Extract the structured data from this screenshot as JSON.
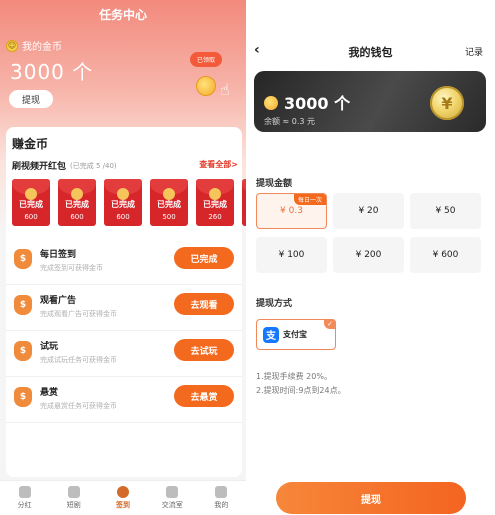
{
  "left": {
    "title": "任务中心",
    "coins": {
      "label": "我的金币",
      "amount": "3000 个",
      "received_tag": "已领取",
      "withdraw_label": "提现"
    },
    "earn": {
      "title": "赚金币",
      "video_title": "刷视频开红包",
      "video_progress": "(已完成 5 /40)",
      "view_all": "查看全部>",
      "packets": [
        {
          "state": "已完成",
          "amount": "600"
        },
        {
          "state": "已完成",
          "amount": "600"
        },
        {
          "state": "已完成",
          "amount": "600"
        },
        {
          "state": "已完成",
          "amount": "500"
        },
        {
          "state": "已完成",
          "amount": "260"
        }
      ],
      "tasks": [
        {
          "name": "每日签到",
          "desc": "完成签到可获得金币",
          "button": "已完成"
        },
        {
          "name": "观看广告",
          "desc": "完成观看广告可获得金币",
          "button": "去观看"
        },
        {
          "name": "试玩",
          "desc": "完成试玩任务可获得金币",
          "button": "去试玩"
        },
        {
          "name": "悬赏",
          "desc": "完成悬赏任务可获得金币",
          "button": "去悬赏"
        }
      ]
    },
    "nav": [
      {
        "label": "分红",
        "active": false
      },
      {
        "label": "短剧",
        "active": false
      },
      {
        "label": "签到",
        "active": true
      },
      {
        "label": "交流室",
        "active": false
      },
      {
        "label": "我的",
        "active": false
      }
    ]
  },
  "right": {
    "back_icon": "‹",
    "title": "我的钱包",
    "record": "记录",
    "wallet": {
      "amount": "3000 个",
      "balance": "余额 ≈ 0.3 元",
      "coin_symbol": "¥"
    },
    "amount_label": "提现金额",
    "amounts": [
      {
        "value": "¥ 0.3",
        "badge": "每日一次",
        "selected": true
      },
      {
        "value": "¥ 20",
        "badge": "",
        "selected": false
      },
      {
        "value": "¥ 50",
        "badge": "",
        "selected": false
      },
      {
        "value": "¥ 100",
        "badge": "",
        "selected": false
      },
      {
        "value": "¥ 200",
        "badge": "",
        "selected": false
      },
      {
        "value": "¥ 600",
        "badge": "",
        "selected": false
      }
    ],
    "method_label": "提现方式",
    "method": {
      "icon_char": "支",
      "name": "支付宝"
    },
    "notes": [
      "1.提现手续费 20%。",
      "2.提现时间:9点到24点。"
    ],
    "withdraw_button": "提现"
  },
  "colors": {
    "accent": "#f36a1e",
    "red": "#d6262a",
    "wallet_dark": "#2a2a2a"
  }
}
